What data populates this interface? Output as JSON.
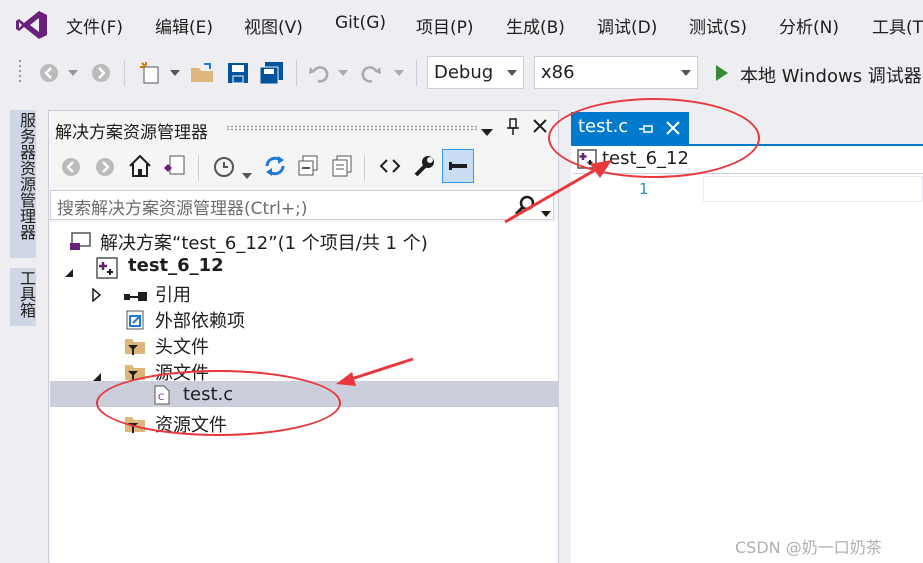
{
  "menu": {
    "items": [
      "文件(F)",
      "编辑(E)",
      "视图(V)",
      "Git(G)",
      "项目(P)",
      "生成(B)",
      "调试(D)",
      "测试(S)",
      "分析(N)",
      "工具(T"
    ]
  },
  "toolbar": {
    "config_value": "Debug",
    "platform_value": "x86",
    "run_label": "本地 Windows 调试器"
  },
  "side_tabs": {
    "server_explorer": "服务器资源管理器",
    "toolbox": "工具箱"
  },
  "solution_explorer": {
    "title": "解决方案资源管理器",
    "search_placeholder": "搜索解决方案资源管理器(Ctrl+;)",
    "tree": {
      "solution": "解决方案“test_6_12”(1 个项目/共 1 个)",
      "project": "test_6_12",
      "references": "引用",
      "external_deps": "外部依赖项",
      "header_files": "头文件",
      "source_files": "源文件",
      "source_file_item": "test.c",
      "resource_files": "资源文件"
    }
  },
  "editor": {
    "tab_label": "test.c",
    "nav_scope": "test_6_12",
    "line_number": "1"
  },
  "watermark": "CSDN @奶一口奶茶",
  "colors": {
    "accent": "#007acc",
    "vs_logo": "#68217a",
    "annotation": "#e8383d",
    "run_green": "#388a34"
  }
}
